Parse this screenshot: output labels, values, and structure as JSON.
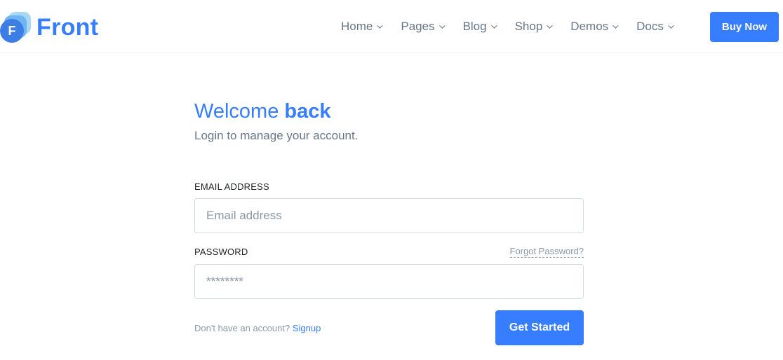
{
  "header": {
    "logo": {
      "mark_letter": "F",
      "text": "Front"
    },
    "nav": [
      {
        "label": "Home",
        "icon": "chevron-down-icon"
      },
      {
        "label": "Pages",
        "icon": "chevron-down-icon"
      },
      {
        "label": "Blog",
        "icon": "chevron-down-icon"
      },
      {
        "label": "Shop",
        "icon": "chevron-down-icon"
      },
      {
        "label": "Demos",
        "icon": "chevron-down-icon"
      },
      {
        "label": "Docs",
        "icon": "chevron-down-icon"
      }
    ],
    "buy_button": "Buy Now"
  },
  "login": {
    "title_light": "Welcome",
    "title_bold": "back",
    "subtitle": "Login to manage your account.",
    "email_label": "Email address",
    "email_placeholder": "Email address",
    "email_value": "",
    "password_label": "Password",
    "forgot_link": "Forgot Password?",
    "password_placeholder": "********",
    "password_value": "",
    "signup_prompt": "Don't have an account?",
    "signup_link": "Signup",
    "submit_button": "Get Started"
  },
  "colors": {
    "primary": "#377dff",
    "text_muted": "#677788",
    "border": "#d5dae2"
  }
}
